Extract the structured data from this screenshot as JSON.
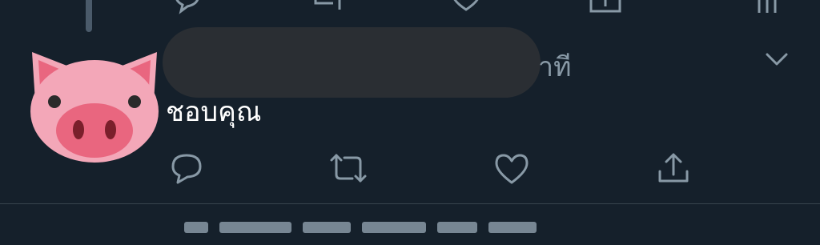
{
  "tweet": {
    "time_fragment": "าที",
    "text": "ชอบคุณ",
    "avatar_icon": "pig-face-icon"
  },
  "actions": [
    {
      "name": "reply-icon"
    },
    {
      "name": "retweet-icon"
    },
    {
      "name": "like-icon"
    },
    {
      "name": "share-icon"
    }
  ],
  "colors": {
    "background": "#15202b",
    "icon": "#8899a6",
    "text": "#ffffff",
    "divider": "#38444d"
  }
}
